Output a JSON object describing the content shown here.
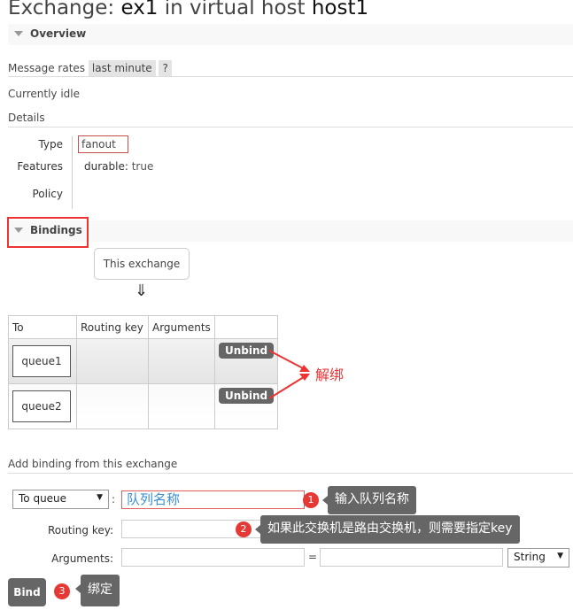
{
  "header": {
    "prefix": "Exchange:",
    "exchange": "ex1",
    "mid": "in virtual host",
    "vhost": "host1"
  },
  "overview": {
    "title": "Overview",
    "message_rates_label": "Message rates",
    "rate_period": "last minute",
    "help": "?",
    "status": "Currently idle",
    "details_label": "Details",
    "type_label": "Type",
    "type_value": "fanout",
    "features_label": "Features",
    "features_key": "durable:",
    "features_value": "true",
    "policy_label": "Policy"
  },
  "bindings": {
    "title": "Bindings",
    "source": "This exchange",
    "arrow": "⇓",
    "columns": [
      "To",
      "Routing key",
      "Arguments",
      ""
    ],
    "rows": [
      {
        "to": "queue1",
        "routing_key": "",
        "arguments": "",
        "action": "Unbind"
      },
      {
        "to": "queue2",
        "routing_key": "",
        "arguments": "",
        "action": "Unbind"
      }
    ],
    "annotation": "解绑"
  },
  "add_binding": {
    "title": "Add binding from this exchange",
    "destination_type": "To queue",
    "colon": ":",
    "destination_value": "队列名称",
    "routing_key_label": "Routing key:",
    "routing_key_value": "",
    "arguments_label": "Arguments:",
    "arg_key": "",
    "equals": "=",
    "arg_value": "",
    "arg_type": "String",
    "bind_label": "Bind",
    "tips": [
      {
        "num": "1",
        "text": "输入队列名称"
      },
      {
        "num": "2",
        "text": "如果此交换机是路由交换机，则需要指定key"
      },
      {
        "num": "3",
        "text": "绑定"
      }
    ]
  }
}
